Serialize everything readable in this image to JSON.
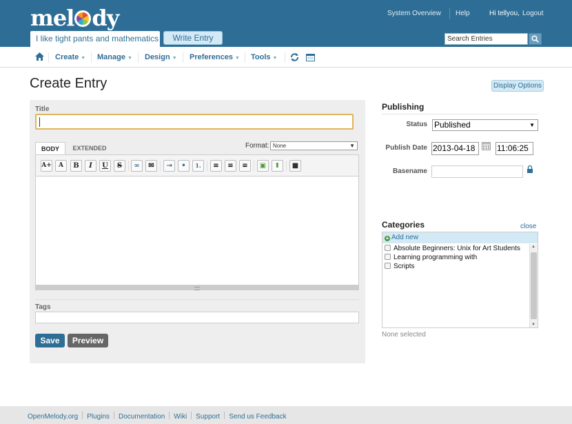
{
  "header": {
    "logo_text_before": "mel",
    "logo_text_after": "dy",
    "blog_name": "I like tight pants and mathematics",
    "write_entry": "Write Entry",
    "system_overview": "System Overview",
    "help": "Help",
    "greeting": "Hi tellyou,",
    "logout": "Logout",
    "search_placeholder": "Search Entries"
  },
  "nav": {
    "items": [
      {
        "label": "Create"
      },
      {
        "label": "Manage"
      },
      {
        "label": "Design"
      },
      {
        "label": "Preferences"
      },
      {
        "label": "Tools"
      }
    ]
  },
  "page": {
    "title": "Create Entry",
    "display_options": "Display Options"
  },
  "editor": {
    "title_label": "Title",
    "title_value": "",
    "tab_body": "BODY",
    "tab_extended": "EXTENDED",
    "format_label": "Format:",
    "format_value": "None",
    "toolbar": [
      {
        "name": "font-size-increase",
        "glyph": "A+"
      },
      {
        "name": "font-size-decrease",
        "glyph": "A"
      },
      {
        "name": "bold",
        "glyph": "B"
      },
      {
        "name": "italic",
        "glyph": "I"
      },
      {
        "name": "underline",
        "glyph": "U"
      },
      {
        "name": "strikethrough",
        "glyph": "S"
      },
      {
        "name": "link",
        "glyph": "∞"
      },
      {
        "name": "email-link",
        "glyph": "✉"
      },
      {
        "name": "indent",
        "glyph": "⇥"
      },
      {
        "name": "bullet-list",
        "glyph": "•"
      },
      {
        "name": "numbered-list",
        "glyph": "1."
      },
      {
        "name": "align-left",
        "glyph": "≡"
      },
      {
        "name": "align-center",
        "glyph": "≡"
      },
      {
        "name": "align-right",
        "glyph": "≡"
      },
      {
        "name": "insert-image",
        "glyph": "▣"
      },
      {
        "name": "insert-file",
        "glyph": "⬆"
      },
      {
        "name": "toggle-html",
        "glyph": "■"
      }
    ],
    "tags_label": "Tags",
    "tags_value": "",
    "save": "Save",
    "preview": "Preview"
  },
  "publishing": {
    "heading": "Publishing",
    "status_label": "Status",
    "status_value": "Published",
    "publish_date_label": "Publish Date",
    "date_value": "2013-04-18",
    "time_value": "11:06:25",
    "basename_label": "Basename",
    "basename_value": ""
  },
  "categories": {
    "heading": "Categories",
    "close": "close",
    "add_new": "Add new",
    "items": [
      {
        "label": "Absolute Beginners: Unix for Art Students",
        "checked": false
      },
      {
        "label": "Learning programming with",
        "checked": false
      },
      {
        "label": "Scripts",
        "checked": false
      }
    ],
    "none_selected": "None selected"
  },
  "footer": {
    "links": [
      "OpenMelody.org",
      "Plugins",
      "Documentation",
      "Wiki",
      "Support",
      "Send us Feedback"
    ]
  },
  "colors": {
    "header_bg": "#2e6e96",
    "accent": "#2e6e96",
    "panel_bg": "#eeeeee",
    "focus_border": "#e0b55a"
  }
}
